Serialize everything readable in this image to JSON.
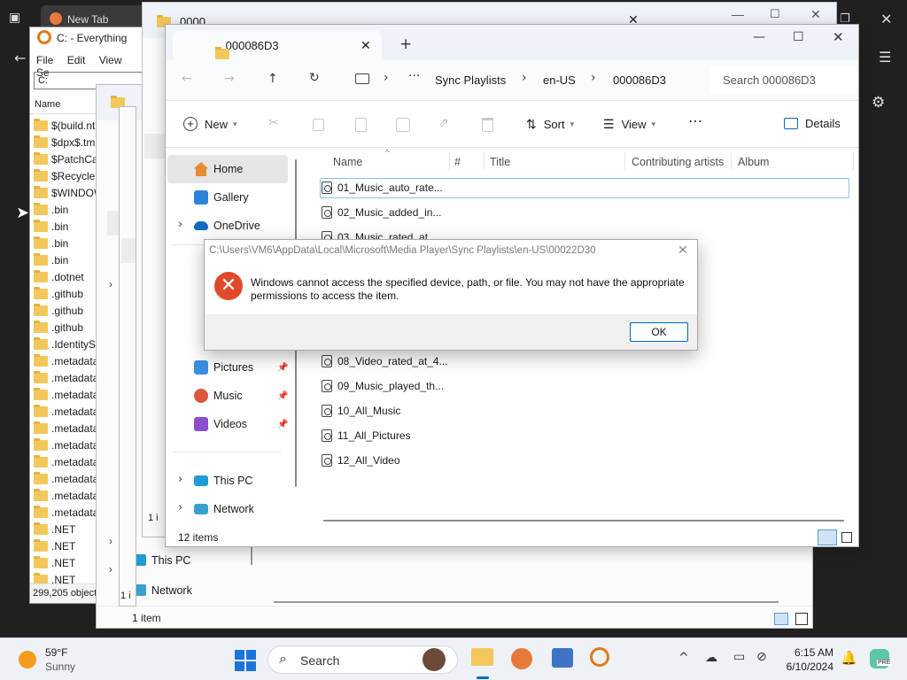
{
  "browser": {
    "tab_title": "New Tab"
  },
  "everything": {
    "title": "C: - Everything",
    "menu": [
      "File",
      "Edit",
      "View",
      "Se"
    ],
    "search_value": "C:",
    "column_name": "Name",
    "items": [
      "$(build.nt",
      "$dpx$.tmp",
      "$PatchCa",
      "$Recycle.B",
      "$WINDOW",
      ".bin",
      ".bin",
      ".bin",
      ".bin",
      ".dotnet",
      ".github",
      ".github",
      ".github",
      ".IdentitySe",
      ".metadata",
      ".metadata",
      ".metadata",
      ".metadata",
      ".metadata",
      ".metadata",
      ".metadata",
      ".metadata",
      ".metadata",
      ".metadata",
      ".NET",
      ".NET",
      ".NET",
      ".NET"
    ],
    "status": "299,205 object"
  },
  "back_explorer": {
    "tab_title": "0000",
    "nav_this_pc": "This PC",
    "nav_network": "Network",
    "status": "1 item",
    "stub_text": "1 i"
  },
  "explorer": {
    "tab_title": "000086D3",
    "breadcrumbs": [
      "Sync Playlists",
      "en-US",
      "000086D3"
    ],
    "search_placeholder": "Search 000086D3",
    "new_label": "New",
    "sort_label": "Sort",
    "view_label": "View",
    "details_label": "Details",
    "nav_items": [
      {
        "label": "Home",
        "icon": "home-icon"
      },
      {
        "label": "Gallery",
        "icon": "gallery-icon"
      },
      {
        "label": "OneDrive",
        "icon": "onedrive-icon"
      },
      {
        "label": "Pictures",
        "icon": "pictures-icon"
      },
      {
        "label": "Music",
        "icon": "music-icon"
      },
      {
        "label": "Videos",
        "icon": "videos-icon"
      },
      {
        "label": "This PC",
        "icon": "this-pc-icon"
      },
      {
        "label": "Network",
        "icon": "network-icon"
      }
    ],
    "columns": [
      "Name",
      "#",
      "Title",
      "Contributing artists",
      "Album"
    ],
    "files": [
      "01_Music_auto_rate...",
      "02_Music_added_in...",
      "03_Music_rated_at...",
      "08_Video_rated_at_4...",
      "09_Music_played_th...",
      "10_All_Music",
      "11_All_Pictures",
      "12_All_Video"
    ],
    "status": "12 items"
  },
  "dialog": {
    "path": "C:\\Users\\VM6\\AppData\\Local\\Microsoft\\Media Player\\Sync Playlists\\en-US\\00022D30",
    "message": "Windows cannot access the specified device, path, or file. You may not have the appropriate permissions to access the item.",
    "ok_label": "OK"
  },
  "taskbar": {
    "weather_temp": "59°F",
    "weather_desc": "Sunny",
    "search_label": "Search",
    "time": "6:15 AM",
    "date": "6/10/2024",
    "copilot_badge": "PRE"
  },
  "colors": {
    "accent": "#0067c0",
    "error": "#e04a2b",
    "folder": "#f2c75c",
    "taskbar": "#eef1f6"
  }
}
